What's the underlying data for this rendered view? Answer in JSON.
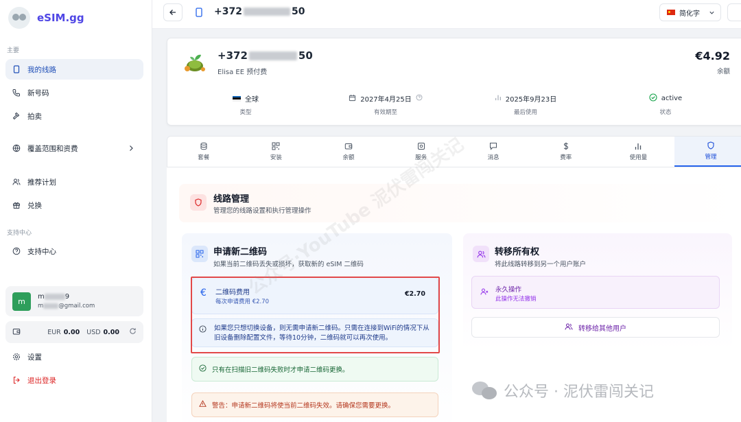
{
  "sidebar": {
    "logo": "eSIM.gg",
    "section_main": "主要",
    "items": [
      {
        "label": "我的线路",
        "icon": "sim-card-icon"
      },
      {
        "label": "新号码",
        "icon": "phone-plus-icon"
      },
      {
        "label": "拍卖",
        "icon": "gavel-icon"
      },
      {
        "label": "覆盖范围和资费",
        "icon": "globe-icon"
      },
      {
        "label": "推荐计划",
        "icon": "users-icon"
      },
      {
        "label": "兑换",
        "icon": "gift-icon"
      }
    ],
    "section_support": "支持中心",
    "support_item": "支持中心",
    "user": {
      "avatar": "m",
      "name_start": "m",
      "name_end": "9",
      "email_start": "m",
      "email_end": "@gmail.com"
    },
    "balance": {
      "eur_label": "EUR",
      "eur_value": "0.00",
      "usd_label": "USD",
      "usd_value": "0.00"
    },
    "settings": "设置",
    "logout": "退出登录"
  },
  "topbar": {
    "number_start": "+372",
    "number_end": "50",
    "language": "简化字"
  },
  "line": {
    "number_start": "+372",
    "number_end": "50",
    "carrier": "Elisa EE 预付费",
    "balance": "€4.92",
    "balance_label": "余额",
    "stats": [
      {
        "value": "全球",
        "label": "类型"
      },
      {
        "value": "2027年4月25日",
        "label": "有效期至"
      },
      {
        "value": "2025年9月23日",
        "label": "最后使用"
      },
      {
        "value": "active",
        "label": "状态"
      }
    ]
  },
  "tabs": [
    "套餐",
    "安装",
    "余额",
    "服务",
    "消息",
    "费率",
    "使用量",
    "管理"
  ],
  "active_tab": "管理",
  "management": {
    "title": "线路管理",
    "subtitle": "管理您的线路设置和执行管理操作",
    "qr": {
      "title": "申请新二维码",
      "subtitle": "如果当前二维码丢失或损坏，获取新的 eSIM 二维码",
      "fee_title": "二维码费用",
      "fee_sub": "每次申请费用 €2.70",
      "fee_amount": "€2.70",
      "info": "如果您只想切换设备，则无需申请新二维码。只需在连接到WiFi的情况下从旧设备删除配置文件，等待10分钟，二维码就可以再次使用。",
      "ok": "只有在扫描旧二维码失败时才申请二维码更换。",
      "warning": "警告：申请新二维码将使当前二维码失效。请确保您需要更换。"
    },
    "transfer": {
      "title": "转移所有权",
      "subtitle": "将此线路转移到另一个用户账户",
      "perm_title": "永久操作",
      "perm_sub": "此操作无法撤销",
      "button": "转移给其他用户"
    }
  },
  "watermarks": {
    "diagonal": "公众号·YouTube 泥伏雷闯关记",
    "corner": "公众号 · 泥伏雷闯关记"
  },
  "colors": {
    "accent": "#2563eb",
    "highlight": "#e24848",
    "brand": "#4f46e5"
  }
}
